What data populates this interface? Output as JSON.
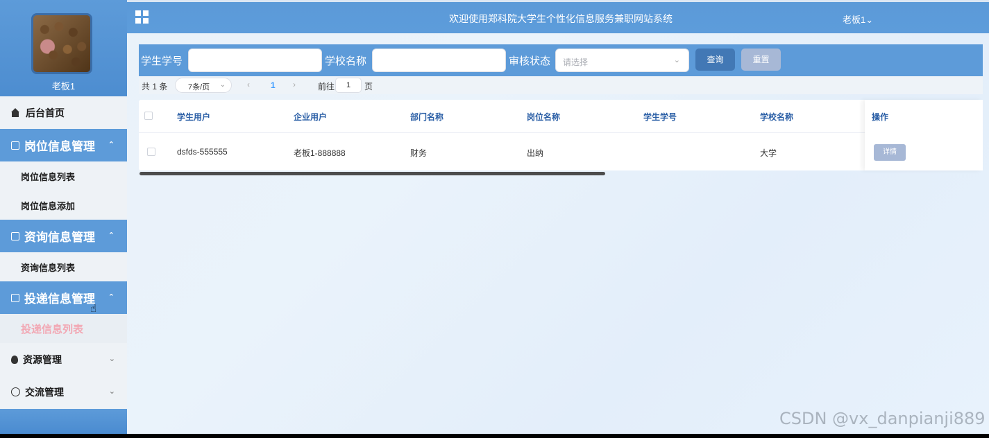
{
  "header": {
    "title": "欢迎使用郑科院大学生个性化信息服务兼职网站系统",
    "user_menu": "老板1",
    "user_menu_caret": "⌄"
  },
  "profile": {
    "name": "老板1"
  },
  "sidebar": {
    "home": "后台首页",
    "groups": [
      {
        "label": "岗位信息管理",
        "expanded": true,
        "items": [
          "岗位信息列表",
          "岗位信息添加"
        ]
      },
      {
        "label": "资询信息管理",
        "expanded": true,
        "items": [
          "资询信息列表"
        ]
      },
      {
        "label": "投递信息管理",
        "expanded": true,
        "items": [
          "投递信息列表"
        ],
        "active_item": "投递信息列表"
      }
    ],
    "collapsed": [
      "资源管理",
      "交流管理"
    ],
    "caret_up": "⌃",
    "caret_down": "⌄"
  },
  "search": {
    "student_no_label": "学生学号",
    "student_no_value": "",
    "school_label": "学校名称",
    "school_value": "",
    "status_label": "审核状态",
    "status_placeholder": "请选择",
    "query_button": "查询",
    "reset_button": "重置"
  },
  "pagination": {
    "total": "共 1 条",
    "page_size": "7条/页",
    "prev": "‹",
    "current_page": "1",
    "next": "›",
    "goto_label": "前往",
    "goto_value": "1",
    "page_unit": "页"
  },
  "table": {
    "columns": [
      "学生用户",
      "企业用户",
      "部门名称",
      "岗位名称",
      "学生学号",
      "学校名称",
      "操作"
    ],
    "rows": [
      {
        "student_user": "dsfds-555555",
        "company_user": "老板1-888888",
        "department": "财务",
        "position": "出纳",
        "student_no": "",
        "school": "大学",
        "action": "详情"
      }
    ]
  },
  "watermark": "CSDN @vx_danpianji889",
  "colors": {
    "primary_blue": "#5d9bd9",
    "query_button": "#4278b5",
    "reset_button": "#a7b8d6",
    "active_menu_text": "#f2a8b4",
    "table_header_text": "#2b5fa6"
  },
  "icons": {
    "home": "home-icon",
    "group": "edit-icon",
    "resource": "bulb-icon",
    "chat": "chat-icon",
    "menu": "grid-icon"
  }
}
